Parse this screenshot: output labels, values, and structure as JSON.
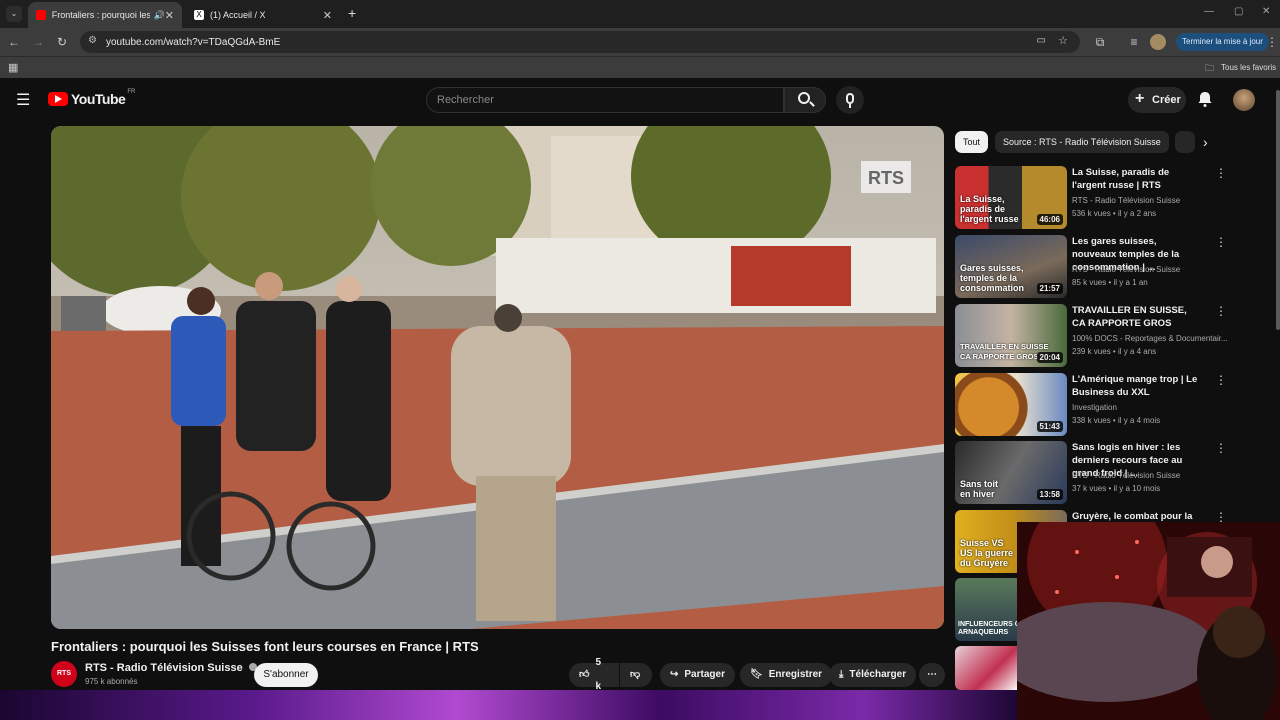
{
  "browser": {
    "tabs": [
      {
        "label": "Frontaliers : pourquoi les Su",
        "active": true
      },
      {
        "label": "(1) Accueil / X",
        "active": false
      }
    ],
    "url": "youtube.com/watch?v=TDaQGdA-BmE",
    "update_button": "Terminer la mise à jour",
    "bookmarks_all": "Tous les favoris"
  },
  "youtube": {
    "logo": "YouTube",
    "country": "FR",
    "search_placeholder": "Rechercher",
    "create_label": "Créer"
  },
  "video": {
    "title": "Frontaliers : pourquoi les Suisses font leurs courses en France | RTS",
    "watermark": "RTS",
    "channel": {
      "name": "RTS - Radio Télévision Suisse",
      "avatar_text": "RTS",
      "subscribers": "975 k abonnés"
    },
    "subscribe_label": "S'abonner",
    "likes": "5 k",
    "share_label": "Partager",
    "save_label": "Enregistrer",
    "download_label": "Télécharger"
  },
  "sidebar": {
    "chips": [
      "Tout",
      "Source : RTS - Radio Télévision Suisse"
    ],
    "recommendations": [
      {
        "title": "La Suisse, paradis de l'argent russe | RTS",
        "channel": "RTS - Radio Télévision Suisse",
        "stats": "536 k vues • il y a 2 ans",
        "duration": "46:06",
        "thumb_text": "La Suisse, paradis de l'argent russe"
      },
      {
        "title": "Les gares suisses, nouveaux temples de la consommation | ...",
        "channel": "RTS - Radio Télévision Suisse",
        "stats": "85 k vues • il y a 1 an",
        "duration": "21:57",
        "thumb_text": "Gares suisses, temples de la consommation"
      },
      {
        "title": "TRAVAILLER EN SUISSE, CA RAPPORTE GROS",
        "channel": "100% DOCS - Reportages & Documentair...",
        "stats": "239 k vues • il y a 4 ans",
        "duration": "20:04",
        "thumb_text": "TRAVAILLER EN SUISSE CA RAPPORTE GROS"
      },
      {
        "title": "L'Amérique mange trop | Le Business du XXL",
        "channel": "Investigation",
        "stats": "338 k vues • il y a 4 mois",
        "duration": "51:43",
        "thumb_text": ""
      },
      {
        "title": "Sans logis en hiver : les derniers recours face au grand froid | ...",
        "channel": "RTS - Radio Télévision Suisse",
        "stats": "37 k vues • il y a 10 mois",
        "duration": "13:58",
        "thumb_text": "Sans toit en hiver"
      },
      {
        "title": "Gruyère, le combat pour la",
        "channel": "",
        "stats": "",
        "duration": "",
        "thumb_text": "Suisse VS US la guerre du Gruyère"
      }
    ],
    "extra_thumbs": [
      {
        "thumb_text": "INFLUENCEURS OU ARNAQUEURS"
      }
    ]
  }
}
